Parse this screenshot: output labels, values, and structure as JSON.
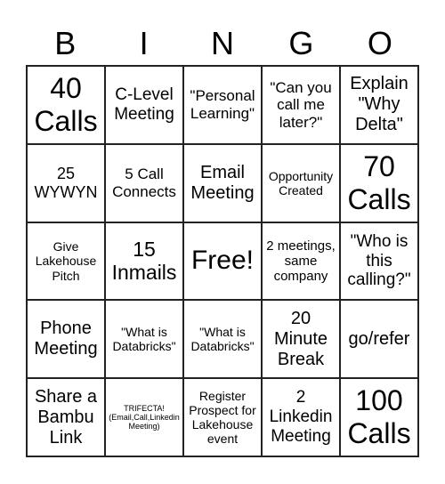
{
  "header": [
    "B",
    "I",
    "N",
    "G",
    "O"
  ],
  "cells": [
    "40 Calls",
    "C-Level Meeting",
    "\"Personal Learning\"",
    "\"Can you call me later?\"",
    "Explain \"Why Delta\"",
    "25 WYWYN",
    "5 Call Connects",
    "Email Meeting",
    "Opportunity Created",
    "70 Calls",
    "Give Lakehouse Pitch",
    "15 Inmails",
    "Free!",
    "2 meetings, same company",
    "\"Who is this calling?\"",
    "Phone Meeting",
    "\"What is Databricks\"",
    "\"What is Databricks\"",
    "20 Minute Break",
    "go/refer",
    "Share a Bambu Link",
    "TRIFECTA! (Email,Call,Linkedin Meeting)",
    "Register Prospect for Lakehouse event",
    "2 Linkedin Meeting",
    "100 Calls"
  ]
}
